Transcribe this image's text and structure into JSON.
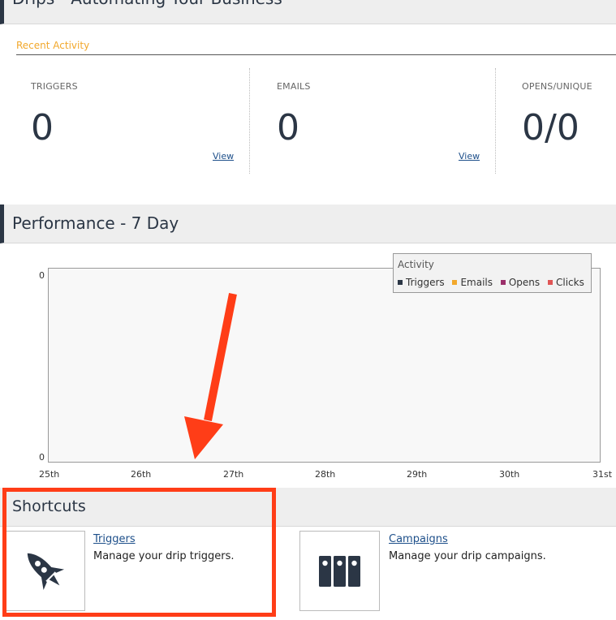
{
  "drips_header": {
    "title": "Drips - Automating Your Business"
  },
  "activity_tab": {
    "label": "Recent Activity"
  },
  "stats": [
    {
      "label": "TRIGGERS",
      "value": "0",
      "link": "View"
    },
    {
      "label": "EMAILS",
      "value": "0",
      "link": "View"
    },
    {
      "label": "OPENS/UNIQUE",
      "value": "0/0"
    }
  ],
  "performance_header": {
    "title": "Performance - 7 Day"
  },
  "chart_data": {
    "type": "line",
    "categories": [
      "25th",
      "26th",
      "27th",
      "28th",
      "29th",
      "30th",
      "31st"
    ],
    "series": [
      {
        "name": "Triggers",
        "values": [],
        "color": "#2b3645"
      },
      {
        "name": "Emails",
        "values": [],
        "color": "#f2a82c"
      },
      {
        "name": "Opens",
        "values": [],
        "color": "#9b2f6a"
      },
      {
        "name": "Clicks",
        "values": [],
        "color": "#e05555"
      }
    ],
    "y_ticks": [
      "0",
      "0"
    ],
    "legend_title": "Activity",
    "legend_position": "top-right"
  },
  "shortcuts_header": {
    "title": "Shortcuts"
  },
  "shortcuts": [
    {
      "link": "Triggers",
      "description": "Manage your drip triggers.",
      "icon": "rocket-icon"
    },
    {
      "link": "Campaigns",
      "description": "Manage your drip campaigns.",
      "icon": "binders-icon"
    }
  ],
  "annotation": {
    "arrow_color": "#ff3d17",
    "box_color": "#ff3d17"
  }
}
